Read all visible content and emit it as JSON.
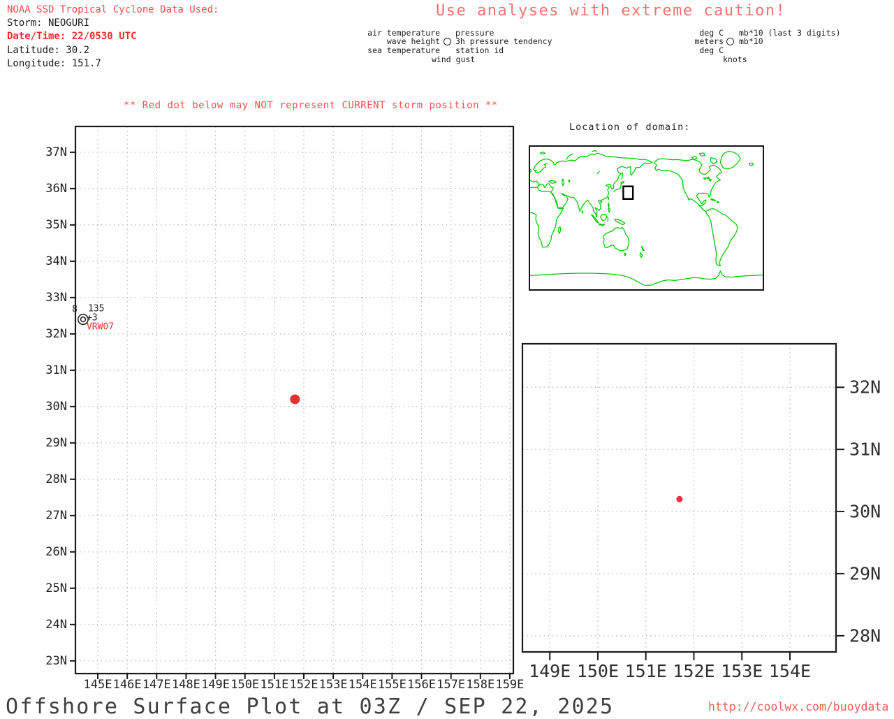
{
  "header": {
    "noaa_line": "NOAA SSD Tropical Cyclone Data Used:",
    "storm_line": "Storm: NEOGURI",
    "datetime_line": "Date/Time: 22/0530 UTC",
    "latitude_line": "Latitude: 30.2",
    "longitude_line": "Longitude: 151.7",
    "caution": "Use analyses with extreme caution!"
  },
  "station_legend": {
    "left": [
      "air temperature",
      "wave height",
      "sea temperature"
    ],
    "right": [
      "pressure",
      "3h pressure tendency",
      "station id"
    ],
    "bottom": "wind gust",
    "circle_icon": "station-circle"
  },
  "units_legend": {
    "left": [
      "deg C",
      "meters",
      "deg C"
    ],
    "right": [
      "mb*10 (last 3 digits)",
      "mb*10"
    ],
    "bottom": "knots",
    "circle_icon": "station-circle"
  },
  "warning": "** Red dot below may NOT represent CURRENT storm position **",
  "map_inset": {
    "title": "Location of domain:",
    "coastline_color": "#00c800",
    "domain_box": {
      "lon_min": 144.2,
      "lon_max": 159.1,
      "lat_min": 22.7,
      "lat_max": 37.7
    }
  },
  "footer": {
    "title": "Offshore Surface Plot at 03Z / SEP 22, 2025",
    "url": "http://coolwx.com/buoydata"
  },
  "chart_data": [
    {
      "type": "scatter",
      "title": "",
      "x_tick_labels": [
        "145E",
        "146E",
        "147E",
        "148E",
        "149E",
        "150E",
        "151E",
        "152E",
        "153E",
        "154E",
        "155E",
        "156E",
        "157E",
        "158E",
        "159E"
      ],
      "y_tick_labels": [
        "37N",
        "36N",
        "35N",
        "34N",
        "33N",
        "32N",
        "31N",
        "30N",
        "29N",
        "28N",
        "27N",
        "26N",
        "25N",
        "24N",
        "23N"
      ],
      "xlim": [
        144.24,
        159.12
      ],
      "ylim": [
        22.65,
        37.71
      ],
      "grid": "dotted-1deg",
      "legend_position": "none",
      "points": [
        {
          "label": "storm",
          "lon": 151.7,
          "lat": 30.2,
          "marker": "filled-circle",
          "color": "#e63232"
        },
        {
          "label": "buoy",
          "lon": 144.5,
          "lat": 32.4,
          "marker": "double-circle",
          "wave_height": "8",
          "pressure": "135",
          "pressure_tendency": "+3",
          "station_id": "VRW07"
        }
      ]
    },
    {
      "type": "scatter",
      "title": "",
      "x_tick_labels": [
        "149E",
        "150E",
        "151E",
        "152E",
        "153E",
        "154E"
      ],
      "y_tick_labels": [
        "32N",
        "31N",
        "30N",
        "29N",
        "28N"
      ],
      "xlim": [
        148.43,
        154.96
      ],
      "ylim": [
        27.74,
        32.7
      ],
      "grid": "dotted-1deg",
      "legend_position": "none",
      "points": [
        {
          "label": "storm",
          "lon": 151.7,
          "lat": 30.2,
          "marker": "filled-circle",
          "color": "#e63232"
        }
      ]
    }
  ]
}
